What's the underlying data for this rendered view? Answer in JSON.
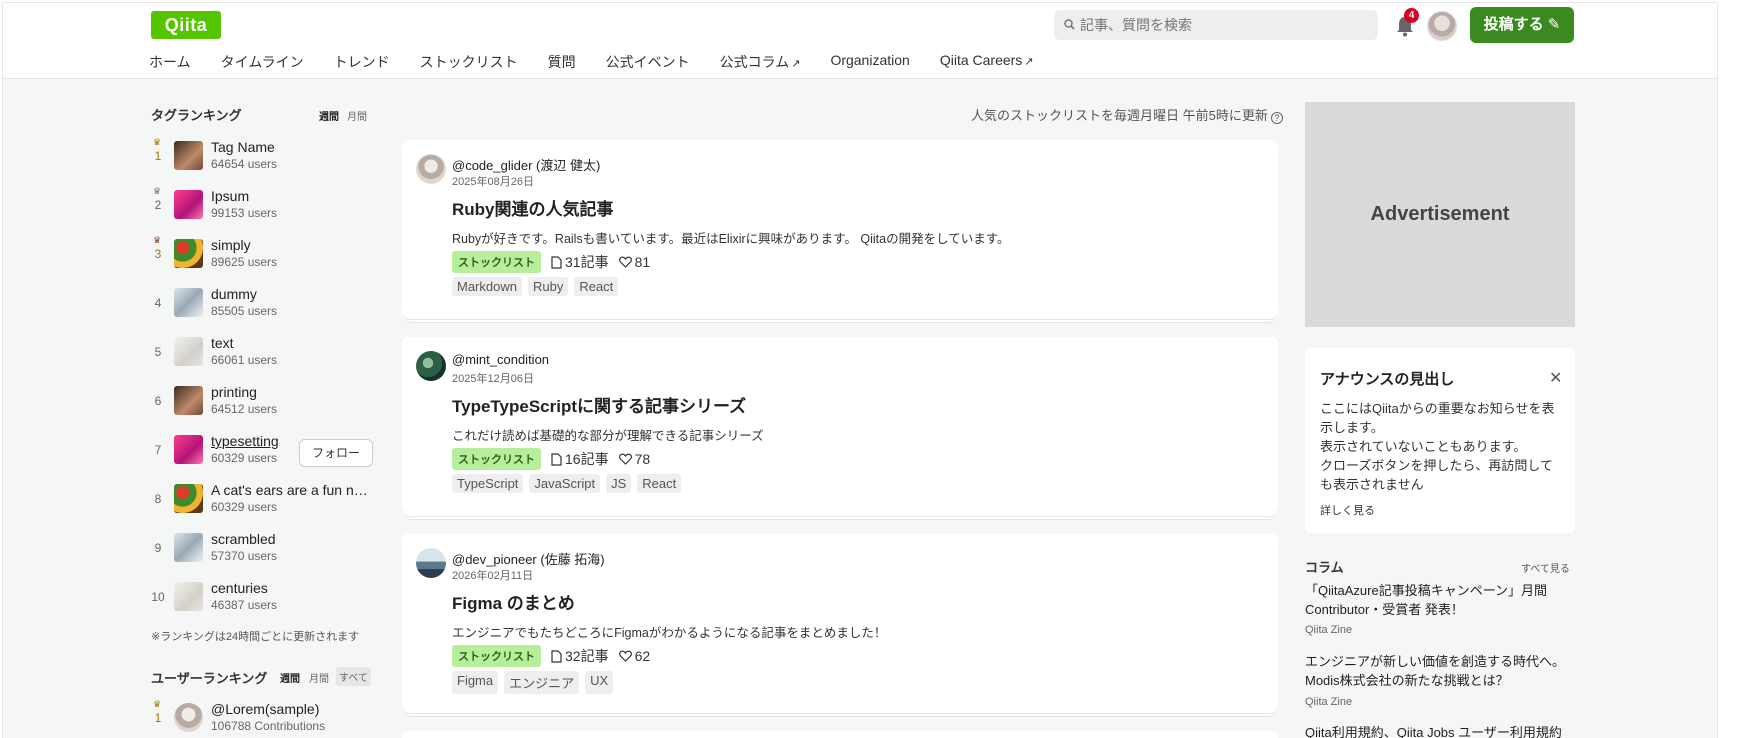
{
  "header": {
    "logo": "Qiita",
    "search_placeholder": "記事、質問を検索",
    "notification_count": "4",
    "post_button": "投稿する ✎"
  },
  "nav": [
    "ホーム",
    "タイムライン",
    "トレンド",
    "ストックリスト",
    "質問",
    "公式イベント",
    "公式コラム",
    "Organization",
    "Qiita Careers"
  ],
  "nav_external_icon": "↗",
  "tag_ranking": {
    "title": "タグランキング",
    "toggle_weekly": "週間",
    "toggle_monthly": "月間",
    "items": [
      {
        "rank": "1",
        "name": "Tag Name",
        "users": "64654 users"
      },
      {
        "rank": "2",
        "name": "Ipsum",
        "users": "99153 users"
      },
      {
        "rank": "3",
        "name": "simply",
        "users": "89625 users"
      },
      {
        "rank": "4",
        "name": "dummy",
        "users": "85505 users"
      },
      {
        "rank": "5",
        "name": "text",
        "users": "66061 users"
      },
      {
        "rank": "6",
        "name": "printing",
        "users": "64512 users"
      },
      {
        "rank": "7",
        "name": "typesetting",
        "users": "60329 users"
      },
      {
        "rank": "8",
        "name": "A cat's ears are a fun n…",
        "users": "60329 users"
      },
      {
        "rank": "9",
        "name": "scrambled",
        "users": "57370 users"
      },
      {
        "rank": "10",
        "name": "centuries",
        "users": "46387 users"
      }
    ],
    "follow_button": "フォロー",
    "note": "※ランキングは24時間ごとに更新されます"
  },
  "user_ranking": {
    "title": "ユーザーランキング",
    "toggle_weekly": "週間",
    "toggle_monthly": "月間",
    "toggle_all": "すべて",
    "items": [
      {
        "rank": "1",
        "name": "@Lorem(sample)",
        "contributions": "106788 Contributions"
      }
    ]
  },
  "feed": {
    "update_note": "人気のストックリストを毎週月曜日 午前5時に更新",
    "cards": [
      {
        "author": "@code_glider (渡辺 健太)",
        "date": "2025年08月26日",
        "title": "Ruby関連の人気記事",
        "desc": "Rubyが好きです。Railsも書いています。最近はElixirに興味があります。 Qiitaの開発をしています。",
        "badge": "ストックリスト",
        "articles": "31記事",
        "likes": "81",
        "tags": [
          "Markdown",
          "Ruby",
          "React"
        ]
      },
      {
        "author": "@mint_condition",
        "date": "2025年12月06日",
        "title": "TypeTypeScriptに関する記事シリーズ",
        "desc": "これだけ読めば基礎的な部分が理解できる記事シリーズ",
        "badge": "ストックリスト",
        "articles": "16記事",
        "likes": "78",
        "tags": [
          "TypeScript",
          "JavaScript",
          "JS",
          "React"
        ]
      },
      {
        "author": "@dev_pioneer (佐藤 拓海)",
        "date": "2026年02月11日",
        "title": "Figma のまとめ",
        "desc": "エンジニアでもたちどころにFigmaがわかるようになる記事をまとめました！",
        "badge": "ストックリスト",
        "articles": "32記事",
        "likes": "62",
        "tags": [
          "Figma",
          "エンジニア",
          "UX"
        ]
      }
    ]
  },
  "sidebar": {
    "ad_label": "Advertisement",
    "announce": {
      "title": "アナウンスの見出し",
      "close": "✕",
      "lines": [
        "ここにはQiitaからの重要なお知らせを表示します。",
        "表示されていないこともあります。",
        "クローズボタンを押したら、再訪問しても表示されません"
      ],
      "more": "詳しく見る"
    },
    "column": {
      "title": "コラム",
      "see_all": "すべて見る",
      "items": [
        {
          "title": "「QiitaAzure記事投稿キャンペーン」月間Contributor・受賞者 発表！",
          "source": "Qiita Zine"
        },
        {
          "title": "エンジニアが新しい価値を創造する時代へ。Modis株式会社の新たな挑戦とは？",
          "source": "Qiita Zine"
        },
        {
          "title": "Qiita利用規約、Qiita Jobs ユーザー利用規約",
          "source": ""
        }
      ]
    }
  }
}
